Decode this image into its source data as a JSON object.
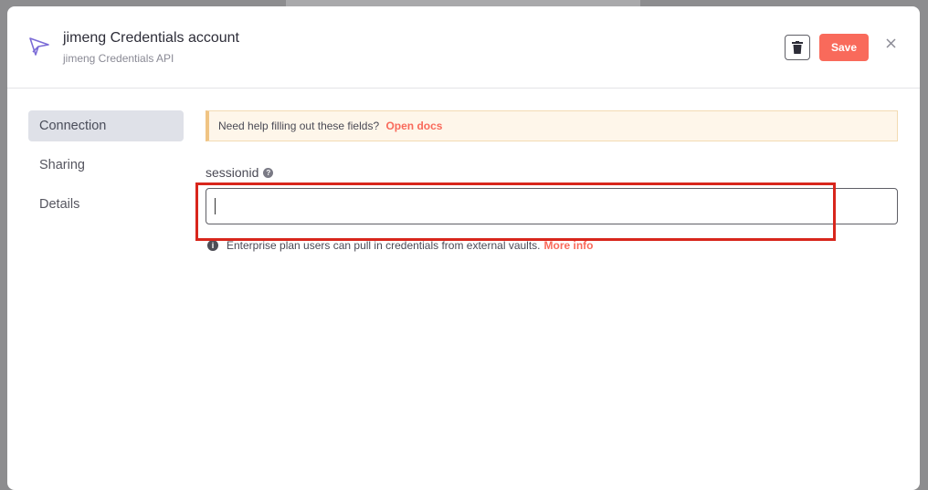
{
  "header": {
    "title": "jimeng Credentials account",
    "subtitle": "jimeng Credentials API",
    "save_label": "Save",
    "delete_icon": "trash-icon",
    "close_icon": "close-icon"
  },
  "sidebar": {
    "items": [
      {
        "label": "Connection",
        "active": true
      },
      {
        "label": "Sharing",
        "active": false
      },
      {
        "label": "Details",
        "active": false
      }
    ]
  },
  "notice": {
    "text": "Need help filling out these fields?",
    "link": "Open docs"
  },
  "field": {
    "label": "sessionid",
    "value": "",
    "help_icon": "question-icon"
  },
  "info": {
    "text": "Enterprise plan users can pull in credentials from external vaults.",
    "link": "More info"
  },
  "colors": {
    "accent": "#f96a5b",
    "highlight_box": "#d8261c",
    "notice_bg": "#fef6ea",
    "sidebar_active_bg": "#dfe1e8"
  }
}
